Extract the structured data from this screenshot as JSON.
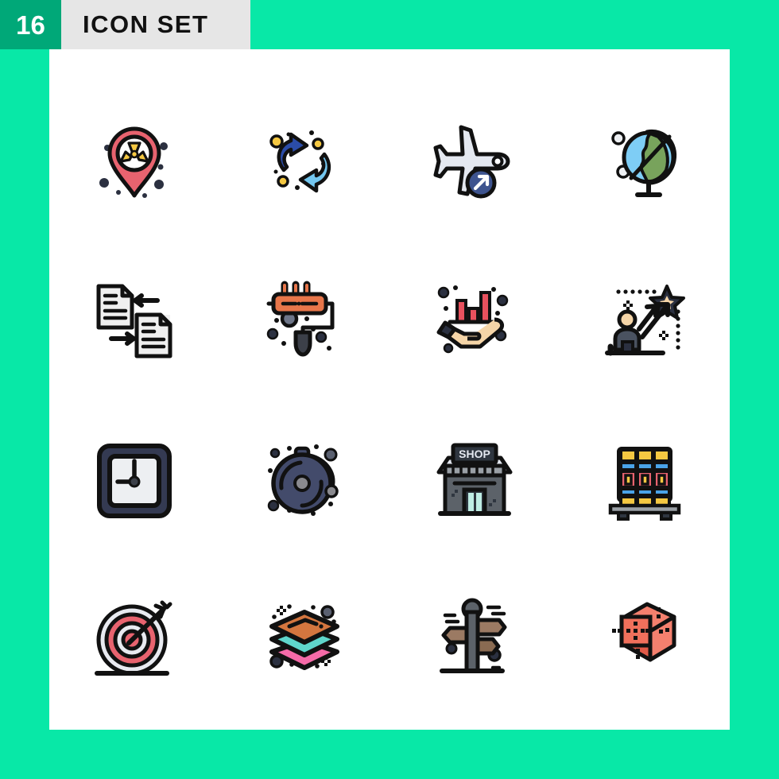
{
  "header": {
    "count": "16",
    "title": "ICON SET",
    "badge_color": "#00A878",
    "bar_color": "#E6E6E6",
    "title_color": "#111111"
  },
  "background_color": "#08E8A7",
  "panel_color": "#FFFFFF",
  "grid": {
    "columns": 4,
    "rows": 4
  },
  "icons": [
    {
      "index": 1,
      "name": "radiation-location-pin-icon",
      "label": "Nuclear location pin",
      "colors": [
        "#E8636F",
        "#F5C842",
        "#111111"
      ]
    },
    {
      "index": 2,
      "name": "refresh-sync-arrows-icon",
      "label": "Refresh sync arrows",
      "colors": [
        "#2B4CA8",
        "#74C7F0",
        "#F5C842"
      ]
    },
    {
      "index": 3,
      "name": "airplane-departure-icon",
      "label": "Airplane departure",
      "colors": [
        "#E4E8F0",
        "#3E548F",
        "#111111"
      ]
    },
    {
      "index": 4,
      "name": "desk-globe-icon",
      "label": "Desk globe",
      "colors": [
        "#7ECDF5",
        "#78A35C",
        "#111111"
      ]
    },
    {
      "index": 5,
      "name": "file-transfer-icon",
      "label": "File transfer",
      "colors": [
        "#EFEFEF",
        "#111111"
      ]
    },
    {
      "index": 6,
      "name": "paint-roller-icon",
      "label": "Paint roller",
      "colors": [
        "#E8764A",
        "#3C4049",
        "#111111"
      ]
    },
    {
      "index": 7,
      "name": "hand-holding-bar-chart-icon",
      "label": "Hand with bar chart",
      "colors": [
        "#F5D5A8",
        "#E8515E",
        "#111111"
      ]
    },
    {
      "index": 8,
      "name": "career-growth-star-icon",
      "label": "Career growth to star",
      "colors": [
        "#3C4049",
        "#F5D5A8",
        "#111111"
      ]
    },
    {
      "index": 9,
      "name": "square-clock-icon",
      "label": "Square clock",
      "colors": [
        "#343A52",
        "#EDEFF2",
        "#111111"
      ]
    },
    {
      "index": 10,
      "name": "vinyl-record-icon",
      "label": "Vinyl record",
      "colors": [
        "#434B6B",
        "#8A8A8F",
        "#111111"
      ]
    },
    {
      "index": 11,
      "name": "shop-storefront-icon",
      "label": "Shop storefront",
      "colors": [
        "#5C6269",
        "#2F3640",
        "#BFEDE4"
      ],
      "sign_text": "SHOP"
    },
    {
      "index": 12,
      "name": "cargo-pallet-icon",
      "label": "Cargo pallet stack",
      "colors": [
        "#F5C842",
        "#4AA3E8",
        "#E8636F",
        "#9AA0A6"
      ]
    },
    {
      "index": 13,
      "name": "target-arrow-icon",
      "label": "Target with arrow",
      "colors": [
        "#E8636F",
        "#E8EAF0",
        "#111111"
      ]
    },
    {
      "index": 14,
      "name": "layers-stack-icon",
      "label": "Layers stack",
      "colors": [
        "#D4763F",
        "#5FD6CC",
        "#F56AA8"
      ]
    },
    {
      "index": 15,
      "name": "signpost-directions-icon",
      "label": "Directional signpost",
      "colors": [
        "#9B7A63",
        "#5C6269",
        "#111111"
      ]
    },
    {
      "index": 16,
      "name": "dotted-cube-icon",
      "label": "Dotted 3D cube",
      "colors": [
        "#F0705C",
        "#E05A48",
        "#111111"
      ]
    }
  ]
}
